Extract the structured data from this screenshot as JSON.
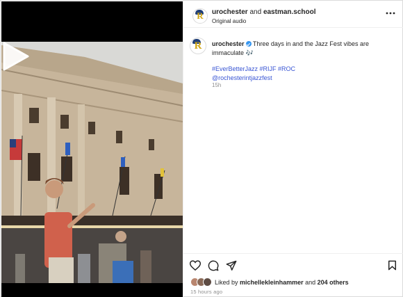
{
  "post": {
    "author": "urochester",
    "connector": "and",
    "collaborator": "eastman.school",
    "audio_label": "Original audio"
  },
  "caption": {
    "username": "urochester",
    "text": "Three days in and the Jazz Fest vibes are immaculate 🎶",
    "hashtags": "#EverBetterJazz #RIJF #ROC",
    "mention": "@rochesterintjazzfest",
    "relative_time": "15h"
  },
  "engagement": {
    "liked_by_prefix": "Liked by",
    "liked_by_user": "michellekleinhammer",
    "and_text": "and",
    "others": "204 others",
    "timestamp": "15 hours ago"
  },
  "icons": {
    "more": "more-horizontal-icon",
    "like": "heart-icon",
    "comment": "comment-icon",
    "share": "send-icon",
    "save": "bookmark-icon",
    "play": "play-icon",
    "avatar_logo": "R"
  },
  "colors": {
    "link": "#3a56d4",
    "verified": "#3897f0",
    "secondary_text": "#8e8e8e"
  }
}
